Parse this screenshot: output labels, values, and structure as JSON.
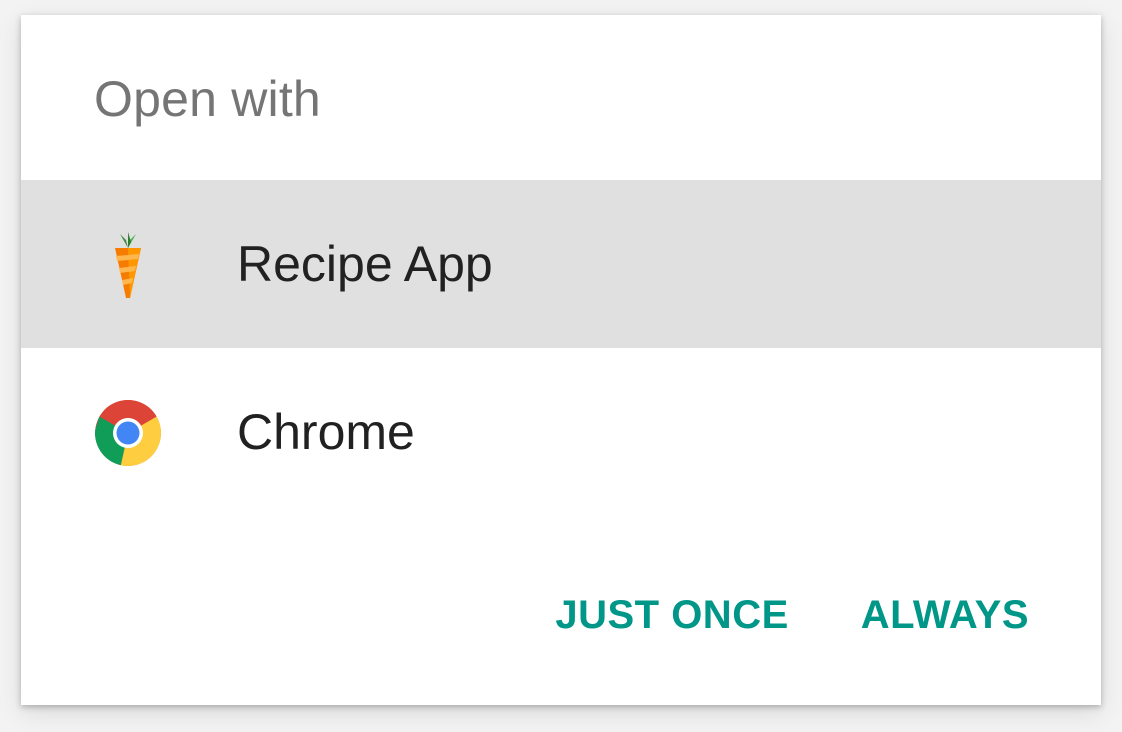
{
  "dialog": {
    "title": "Open with"
  },
  "apps": [
    {
      "label": "Recipe App",
      "icon": "carrot-icon",
      "selected": true
    },
    {
      "label": "Chrome",
      "icon": "chrome-icon",
      "selected": false
    }
  ],
  "actions": {
    "just_once_label": "JUST ONCE",
    "always_label": "ALWAYS"
  },
  "colors": {
    "accent": "#009688",
    "selected_row": "#e0e0e0",
    "title_text": "#757575",
    "item_text": "#212121"
  }
}
